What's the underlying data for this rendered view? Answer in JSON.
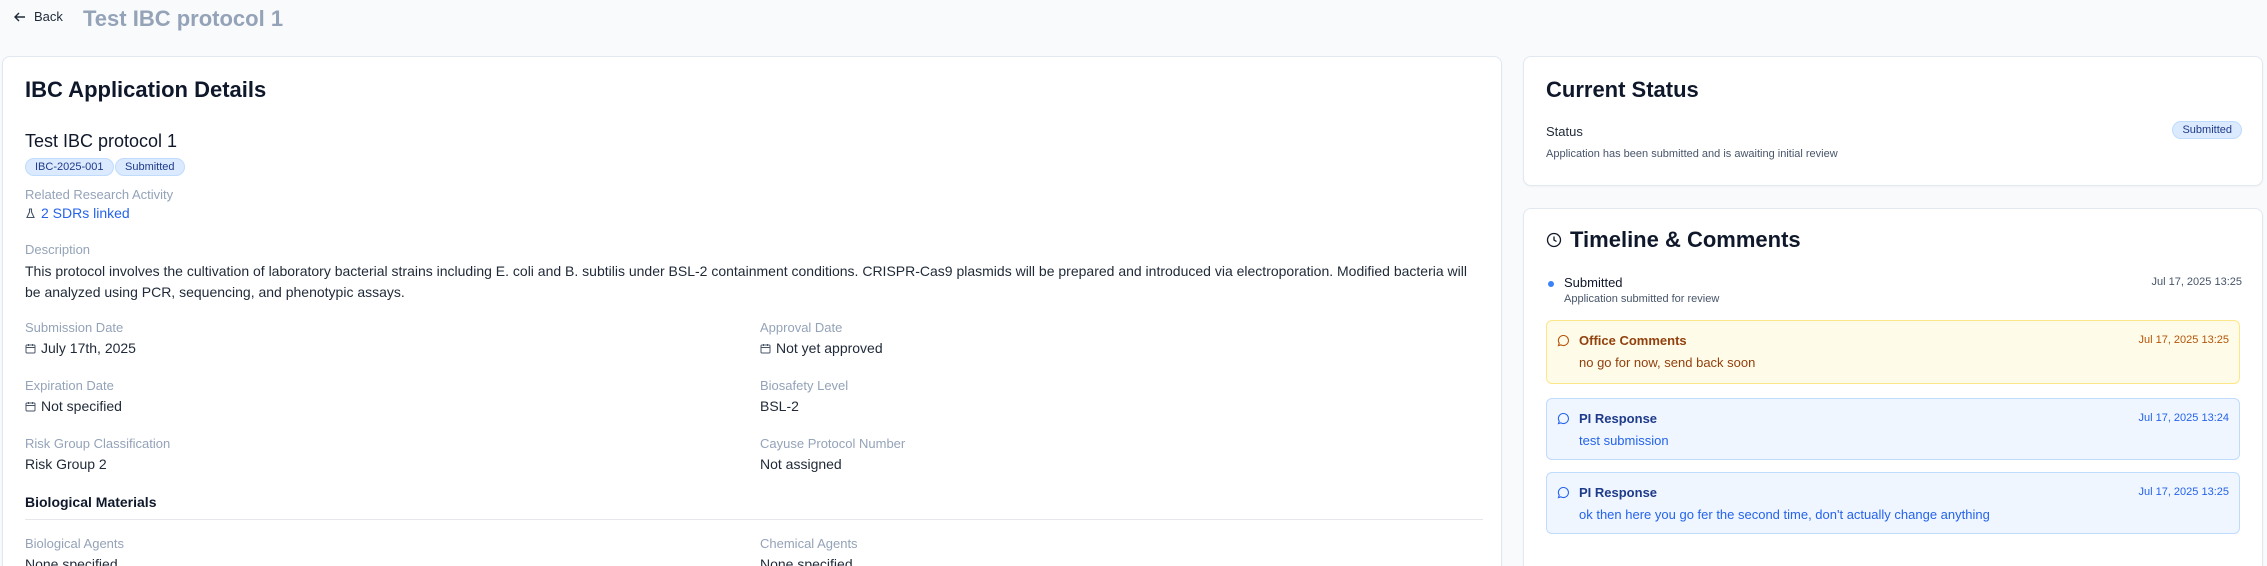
{
  "header": {
    "back_label": "Back",
    "title": "Test IBC protocol 1"
  },
  "details": {
    "heading": "IBC Application Details",
    "protocol_name": "Test IBC protocol 1",
    "badges": [
      "IBC-2025-001",
      "Submitted"
    ],
    "related_label": "Related Research Activity",
    "related_value": "2 SDRs linked",
    "description_label": "Description",
    "description": "This protocol involves the cultivation of laboratory bacterial strains including E. coli and B. subtilis under BSL-2 containment conditions. CRISPR-Cas9 plasmids will be prepared and introduced via electroporation. Modified bacteria will be analyzed using PCR, sequencing, and phenotypic assays.",
    "fields": [
      {
        "label": "Submission Date",
        "value": "July 17th, 2025",
        "icon": "calendar-icon"
      },
      {
        "label": "Approval Date",
        "value": "Not yet approved",
        "icon": "calendar-icon"
      },
      {
        "label": "Expiration Date",
        "value": "Not specified",
        "icon": "calendar-icon"
      },
      {
        "label": "Biosafety Level",
        "value": "BSL-2",
        "icon": ""
      },
      {
        "label": "Risk Group Classification",
        "value": "Risk Group 2",
        "icon": ""
      },
      {
        "label": "Cayuse Protocol Number",
        "value": "Not assigned",
        "icon": ""
      }
    ],
    "bio_section_title": "Biological Materials",
    "bio_fields": [
      {
        "label": "Biological Agents",
        "value": "None specified"
      },
      {
        "label": "Chemical Agents",
        "value": "None specified"
      }
    ]
  },
  "status": {
    "heading": "Current Status",
    "label": "Status",
    "badge": "Submitted",
    "description": "Application has been submitted and is awaiting initial review"
  },
  "timeline": {
    "heading": "Timeline & Comments",
    "event": {
      "title": "Submitted",
      "subtitle": "Application submitted for review",
      "date": "Jul 17, 2025 13:25"
    },
    "comments": [
      {
        "type": "office",
        "title": "Office Comments",
        "date": "Jul 17, 2025 13:25",
        "text": "no go for now, send back soon"
      },
      {
        "type": "pi",
        "title": "PI Response",
        "date": "Jul 17, 2025 13:24",
        "text": "test submission"
      },
      {
        "type": "pi",
        "title": "PI Response",
        "date": "Jul 17, 2025 13:25",
        "text": "ok then here you go fer the second time, don't actually change anything"
      }
    ]
  },
  "colors": {
    "accent": "#2563eb",
    "badge_bg": "#dbeafe",
    "office_bg": "#fefce8",
    "pi_bg": "#eff6ff"
  }
}
